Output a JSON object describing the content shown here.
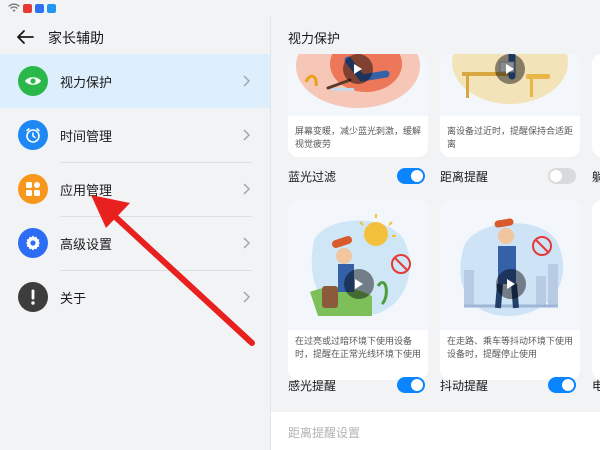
{
  "header": {
    "back_icon": "arrow-left-icon",
    "title": "家长辅助"
  },
  "menu": [
    {
      "label": "视力保护",
      "icon": "eye-icon",
      "color": "#2bb84a",
      "selected": true
    },
    {
      "label": "时间管理",
      "icon": "clock-icon",
      "color": "#1e88f5",
      "selected": false
    },
    {
      "label": "应用管理",
      "icon": "apps-grid-icon",
      "color": "#f7981c",
      "selected": false
    },
    {
      "label": "高级设置",
      "icon": "gear-icon",
      "color": "#2d6df6",
      "selected": false
    },
    {
      "label": "关于",
      "icon": "exclamation-icon",
      "color": "#3d3d3d",
      "selected": false
    }
  ],
  "detail": {
    "title": "视力保护",
    "cards": [
      {
        "desc": "屏幕变暖，减少蓝光刺激，缓解视觉疲劳",
        "toggle_label": "蓝光过滤",
        "on": true
      },
      {
        "desc": "离设备过近时，提醒保持合适距离",
        "toggle_label": "距离提醒",
        "on": false
      },
      {
        "desc": "在过亮或过暗环境下使用设备时，提醒在正常光线环境下使用",
        "toggle_label": "感光提醒",
        "on": true
      },
      {
        "desc": "在走路、乘车等抖动环境下使用设备时，提醒停止使用",
        "toggle_label": "抖动提醒",
        "on": true
      }
    ],
    "partial_labels": [
      "躺",
      "电"
    ],
    "bottom_setting": "距离提醒设置"
  },
  "colors": {
    "accent": "#0a84ff",
    "selected_bg": "#ddeefc",
    "annotation_arrow": "#e8201e"
  }
}
